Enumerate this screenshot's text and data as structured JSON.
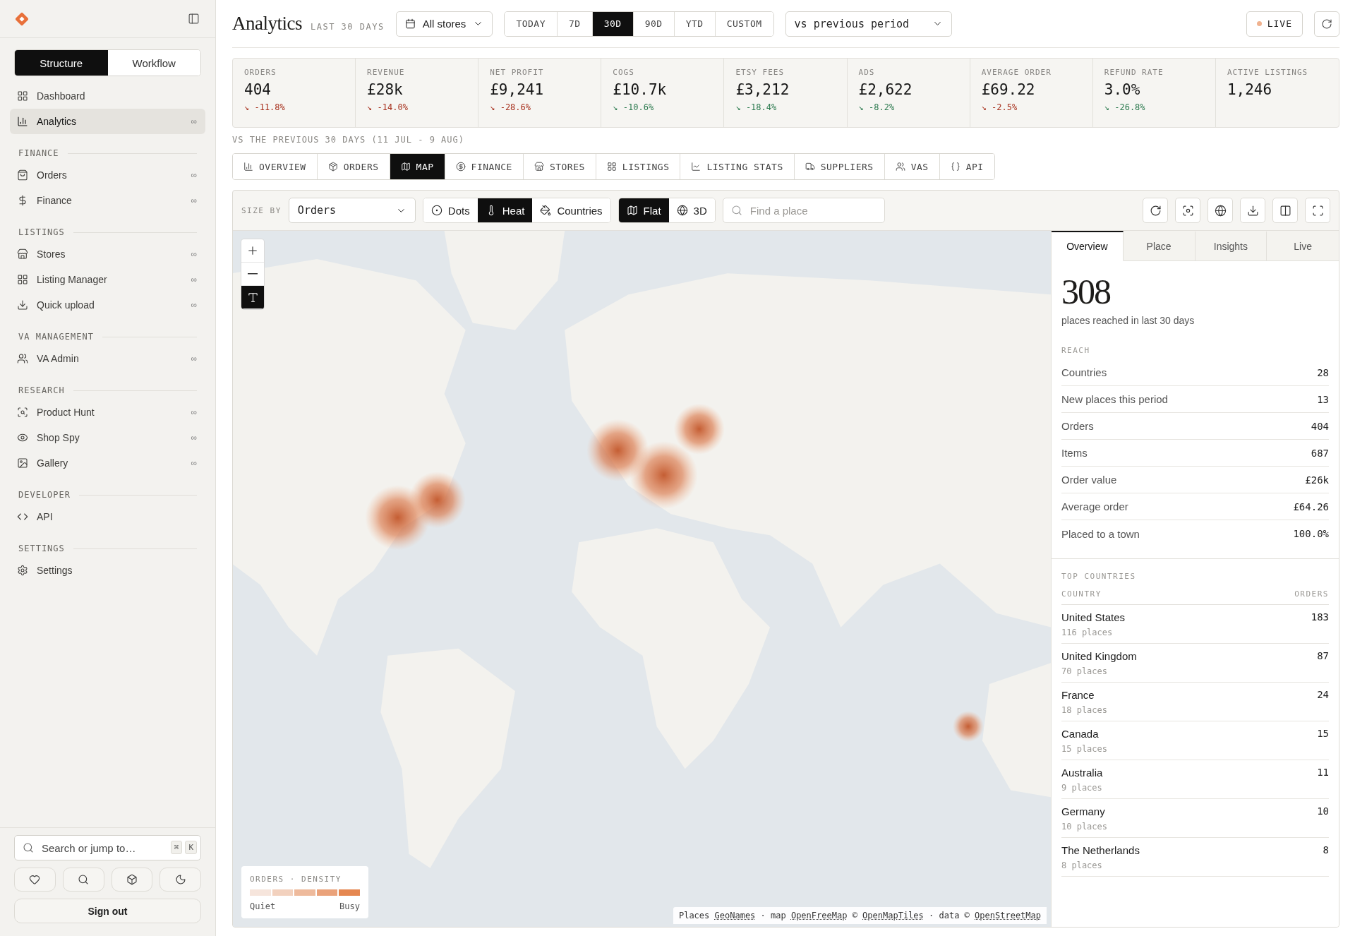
{
  "sidebar": {
    "segments": [
      {
        "label": "Structure",
        "selected": true
      },
      {
        "label": "Workflow",
        "selected": false
      }
    ],
    "top_items": [
      {
        "label": "Dashboard",
        "selected": false
      },
      {
        "label": "Analytics",
        "selected": true,
        "badge": "∞"
      }
    ],
    "sections": [
      {
        "title": "FINANCE",
        "items": [
          {
            "label": "Orders",
            "selected": false,
            "badge": "∞"
          },
          {
            "label": "Finance",
            "selected": false,
            "badge": "∞"
          }
        ]
      },
      {
        "title": "LISTINGS",
        "items": [
          {
            "label": "Stores",
            "selected": false,
            "badge": "∞"
          },
          {
            "label": "Listing Manager",
            "selected": false,
            "badge": "∞"
          },
          {
            "label": "Quick upload",
            "selected": false,
            "badge": "∞"
          }
        ]
      },
      {
        "title": "VA MANAGEMENT",
        "items": [
          {
            "label": "VA Admin",
            "selected": false,
            "badge": "∞"
          }
        ]
      },
      {
        "title": "RESEARCH",
        "items": [
          {
            "label": "Product Hunt",
            "selected": false,
            "badge": "∞"
          },
          {
            "label": "Shop Spy",
            "selected": false,
            "badge": "∞"
          },
          {
            "label": "Gallery",
            "selected": false,
            "badge": "∞"
          }
        ]
      },
      {
        "title": "DEVELOPER",
        "items": [
          {
            "label": "API",
            "selected": false
          }
        ]
      },
      {
        "title": "SETTINGS",
        "items": [
          {
            "label": "Settings",
            "selected": false
          }
        ]
      }
    ],
    "search": {
      "placeholder": "Search or jump to…",
      "keys": [
        "⌘",
        "K"
      ]
    },
    "sign_out": "Sign out"
  },
  "header": {
    "title": "Analytics",
    "subtitle": "LAST 30 DAYS",
    "store": "All stores",
    "ranges": [
      {
        "label": "TODAY",
        "selected": false
      },
      {
        "label": "7D",
        "selected": false
      },
      {
        "label": "30D",
        "selected": true
      },
      {
        "label": "90D",
        "selected": false
      },
      {
        "label": "YTD",
        "selected": false
      },
      {
        "label": "CUSTOM",
        "selected": false
      }
    ],
    "compare": "vs previous period",
    "live": "LIVE"
  },
  "kpis": [
    {
      "label": "ORDERS",
      "value": "404",
      "delta": "↘ -11.8%",
      "color": "#a8321f"
    },
    {
      "label": "REVENUE",
      "value": "£28k",
      "delta": "↘ -14.0%",
      "color": "#a8321f"
    },
    {
      "label": "NET PROFIT",
      "value": "£9,241",
      "delta": "↘ -28.6%",
      "color": "#a8321f"
    },
    {
      "label": "COGS",
      "value": "£10.7k",
      "delta": "↘ -10.6%",
      "color": "#2c7a4f"
    },
    {
      "label": "ETSY FEES",
      "value": "£3,212",
      "delta": "↘ -18.4%",
      "color": "#2c7a4f"
    },
    {
      "label": "ADS",
      "value": "£2,622",
      "delta": "↘ -8.2%",
      "color": "#2c7a4f"
    },
    {
      "label": "AVERAGE ORDER",
      "value": "£69.22",
      "delta": "↘ -2.5%",
      "color": "#a8321f"
    },
    {
      "label": "REFUND RATE",
      "value": "3.0%",
      "delta": "↘ -26.8%",
      "color": "#2c7a4f"
    },
    {
      "label": "ACTIVE LISTINGS",
      "value": "1,246"
    }
  ],
  "comparison_note": "VS THE PREVIOUS 30 DAYS (11 JUL - 9 AUG)",
  "tabs": [
    {
      "label": "OVERVIEW",
      "selected": false
    },
    {
      "label": "ORDERS",
      "selected": false
    },
    {
      "label": "MAP",
      "selected": true
    },
    {
      "label": "FINANCE",
      "selected": false
    },
    {
      "label": "STORES",
      "selected": false
    },
    {
      "label": "LISTINGS",
      "selected": false
    },
    {
      "label": "LISTING STATS",
      "selected": false
    },
    {
      "label": "SUPPLIERS",
      "selected": false
    },
    {
      "label": "VAS",
      "selected": false
    },
    {
      "label": "API",
      "selected": false
    }
  ],
  "map": {
    "size_by_label": "SIZE BY",
    "size_by": "Orders",
    "layers": [
      {
        "label": "Dots",
        "selected": false
      },
      {
        "label": "Heat",
        "selected": true
      },
      {
        "label": "Countries",
        "selected": false
      }
    ],
    "projections": [
      {
        "label": "Flat",
        "selected": true
      },
      {
        "label": "3D",
        "selected": false
      }
    ],
    "search_placeholder": "Find a place",
    "labels_on": true,
    "legend": {
      "title": "ORDERS · DENSITY",
      "low": "Quiet",
      "high": "Busy"
    },
    "attribution": [
      {
        "text": "Places",
        "link": false
      },
      {
        "text": "GeoNames",
        "link": true
      },
      {
        "text": "· map",
        "link": false
      },
      {
        "text": "OpenFreeMap",
        "link": true
      },
      {
        "text": "©",
        "link": false
      },
      {
        "text": "OpenMapTiles",
        "link": true
      },
      {
        "text": "· data ©",
        "link": false
      },
      {
        "text": "OpenStreetMap",
        "link": true
      }
    ]
  },
  "panel": {
    "tabs": [
      {
        "label": "Overview",
        "selected": true
      },
      {
        "label": "Place",
        "selected": false
      },
      {
        "label": "Insights",
        "selected": false
      },
      {
        "label": "Live",
        "selected": false
      }
    ],
    "big_number": "308",
    "caption": "places reached in last 30 days",
    "reach_title": "REACH",
    "reach": [
      {
        "label": "Countries",
        "value": "28"
      },
      {
        "label": "New places this period",
        "value": "13"
      },
      {
        "label": "Orders",
        "value": "404"
      },
      {
        "label": "Items",
        "value": "687"
      },
      {
        "label": "Order value",
        "value": "£26k"
      },
      {
        "label": "Average order",
        "value": "£64.26"
      },
      {
        "label": "Placed to a town",
        "value": "100.0%"
      }
    ],
    "top_title": "TOP COUNTRIES",
    "columns": [
      "COUNTRY",
      "ORDERS"
    ],
    "countries": [
      {
        "name": "United States",
        "orders": "183",
        "places": "116 places"
      },
      {
        "name": "United Kingdom",
        "orders": "87",
        "places": "70 places"
      },
      {
        "name": "France",
        "orders": "24",
        "places": "18 places"
      },
      {
        "name": "Canada",
        "orders": "15",
        "places": "15 places"
      },
      {
        "name": "Australia",
        "orders": "11",
        "places": "9 places"
      },
      {
        "name": "Germany",
        "orders": "10",
        "places": "10 places"
      },
      {
        "name": "The Netherlands",
        "orders": "8",
        "places": "8 places"
      }
    ]
  }
}
